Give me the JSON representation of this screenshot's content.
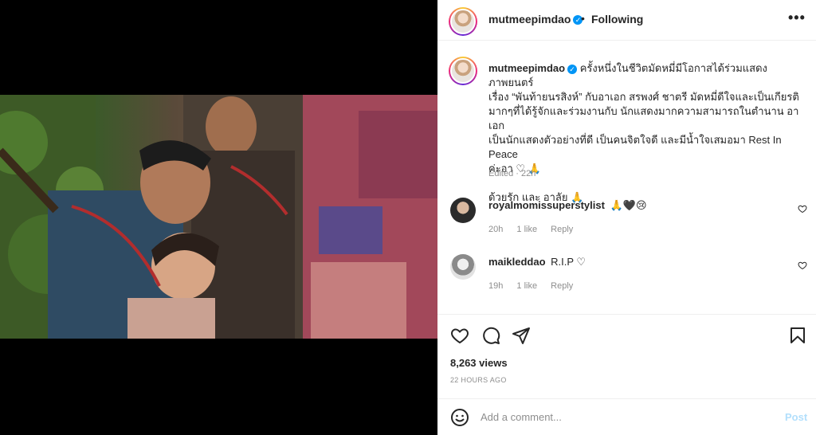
{
  "post": {
    "author": "mutmeepimdao",
    "follow_status": "Following",
    "dot": "•",
    "more_label": "•••"
  },
  "caption": {
    "username": "mutmeepimdao",
    "line1": "ครั้งหนึ่งในชีวิตมัดหมี่มีโอกาสได้ร่วมแสดงภาพยนตร์",
    "line2": "เรื่อง “พันท้ายนรสิงห์” กับอาเอก สรพงศ์ ชาตรี มัดหมี่ดีใจและเป็นเกียรติ",
    "line3": "มากๆที่ได้รู้จักและร่วมงานกับ นักแสดงมากความสามารถในตำนาน อาเอก",
    "line4": "เป็นนักแสดงตัวอย่างที่ดี เป็นคนจิตใจดี และมีน้ำใจเสมอมา Rest In Peace",
    "line5": "ค่ะอา ♡ 🙏",
    "line6": "ด้วยรัก และ อาลัย 🙏",
    "edited": "Edited · 22h"
  },
  "comments": [
    {
      "username": "royalmomissuperstylist",
      "text": "🙏🖤😢",
      "time": "20h",
      "likes": "1 like",
      "reply": "Reply"
    },
    {
      "username": "maikleddao",
      "text": "R.I.P ♡",
      "time": "19h",
      "likes": "1 like",
      "reply": "Reply"
    }
  ],
  "stats": {
    "views": "8,263 views",
    "time_ago": "22 HOURS AGO"
  },
  "add_comment": {
    "placeholder": "Add a comment...",
    "post_label": "Post"
  },
  "colors": {
    "verified": "#0095f6",
    "post_disabled": "#b2dffc",
    "meta": "#8e8e8e"
  },
  "icons": [
    "heart-icon",
    "comment-icon",
    "share-icon",
    "bookmark-icon",
    "more-icon",
    "emoji-icon",
    "verified-icon"
  ]
}
